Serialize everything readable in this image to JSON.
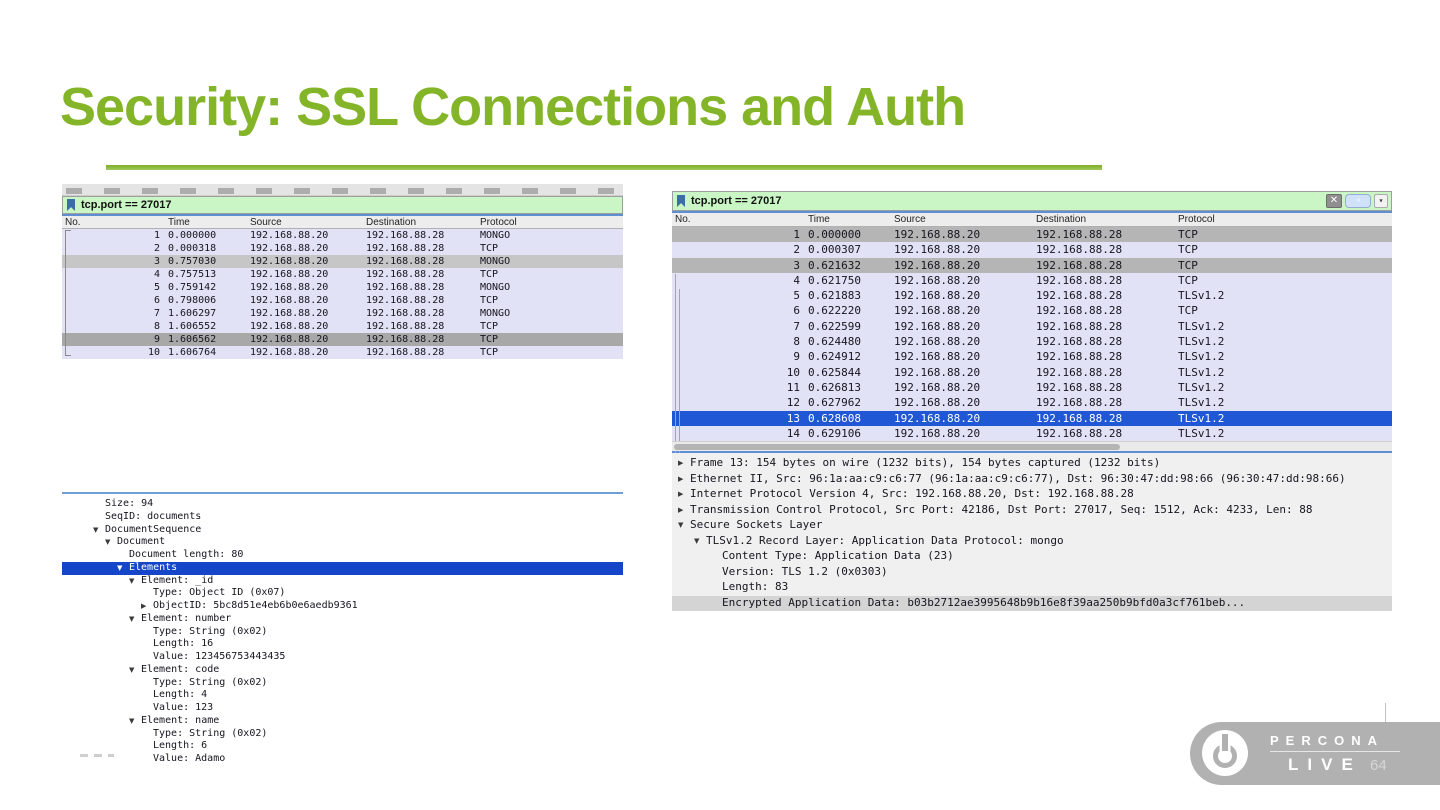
{
  "slide": {
    "title": "Security: SSL Connections and Auth",
    "page_number": "64"
  },
  "brand": {
    "name_top": "PERCONA",
    "name_bottom": "LIVE",
    "power_icon": "power-icon"
  },
  "colors": {
    "accent_green": "#84b529",
    "filter_green": "#c9f6c4",
    "row_lavender": "#e2e2f6",
    "selected_blue": "#1f57d5",
    "tree_selected_blue": "#1546c9",
    "highlight_gray": "#b5b5b5",
    "badge_gray": "#b1b1b1"
  },
  "left_capture": {
    "filter": "tcp.port == 27017",
    "columns": [
      "No.",
      "Time",
      "Source",
      "Destination",
      "Protocol"
    ],
    "rows": [
      {
        "no": "1",
        "time": "0.000000",
        "source": "192.168.88.20",
        "destination": "192.168.88.28",
        "protocol": "MONGO",
        "hl": ""
      },
      {
        "no": "2",
        "time": "0.000318",
        "source": "192.168.88.20",
        "destination": "192.168.88.28",
        "protocol": "TCP",
        "hl": ""
      },
      {
        "no": "3",
        "time": "0.757030",
        "source": "192.168.88.20",
        "destination": "192.168.88.28",
        "protocol": "MONGO",
        "hl": "gray1"
      },
      {
        "no": "4",
        "time": "0.757513",
        "source": "192.168.88.20",
        "destination": "192.168.88.28",
        "protocol": "TCP",
        "hl": ""
      },
      {
        "no": "5",
        "time": "0.759142",
        "source": "192.168.88.20",
        "destination": "192.168.88.28",
        "protocol": "MONGO",
        "hl": ""
      },
      {
        "no": "6",
        "time": "0.798006",
        "source": "192.168.88.20",
        "destination": "192.168.88.28",
        "protocol": "TCP",
        "hl": ""
      },
      {
        "no": "7",
        "time": "1.606297",
        "source": "192.168.88.20",
        "destination": "192.168.88.28",
        "protocol": "MONGO",
        "hl": ""
      },
      {
        "no": "8",
        "time": "1.606552",
        "source": "192.168.88.20",
        "destination": "192.168.88.28",
        "protocol": "TCP",
        "hl": ""
      },
      {
        "no": "9",
        "time": "1.606562",
        "source": "192.168.88.20",
        "destination": "192.168.88.28",
        "protocol": "TCP",
        "hl": "gray2"
      },
      {
        "no": "10",
        "time": "1.606764",
        "source": "192.168.88.20",
        "destination": "192.168.88.28",
        "protocol": "TCP",
        "hl": ""
      }
    ],
    "tree": [
      {
        "icon": "",
        "level": 0,
        "text": "Size: 94",
        "hl": ""
      },
      {
        "icon": "",
        "level": 0,
        "text": "SeqID: documents",
        "hl": ""
      },
      {
        "icon": "down",
        "level": 0,
        "text": "DocumentSequence",
        "hl": ""
      },
      {
        "icon": "down",
        "level": 1,
        "text": "Document",
        "hl": ""
      },
      {
        "icon": "",
        "level": 2,
        "text": "Document length: 80",
        "hl": ""
      },
      {
        "icon": "down",
        "level": 2,
        "text": "Elements",
        "hl": "treeblue"
      },
      {
        "icon": "down",
        "level": 3,
        "text": "Element: _id",
        "hl": ""
      },
      {
        "icon": "",
        "level": 4,
        "text": "Type: Object ID (0x07)",
        "hl": ""
      },
      {
        "icon": "right",
        "level": 4,
        "text": "ObjectID: 5bc8d51e4eb6b0e6aedb9361",
        "hl": ""
      },
      {
        "icon": "down",
        "level": 3,
        "text": "Element: number",
        "hl": ""
      },
      {
        "icon": "",
        "level": 4,
        "text": "Type: String (0x02)",
        "hl": ""
      },
      {
        "icon": "",
        "level": 4,
        "text": "Length: 16",
        "hl": ""
      },
      {
        "icon": "",
        "level": 4,
        "text": "Value: 123456753443435",
        "hl": ""
      },
      {
        "icon": "down",
        "level": 3,
        "text": "Element: code",
        "hl": ""
      },
      {
        "icon": "",
        "level": 4,
        "text": "Type: String (0x02)",
        "hl": ""
      },
      {
        "icon": "",
        "level": 4,
        "text": "Length: 4",
        "hl": ""
      },
      {
        "icon": "",
        "level": 4,
        "text": "Value: 123",
        "hl": ""
      },
      {
        "icon": "down",
        "level": 3,
        "text": "Element: name",
        "hl": ""
      },
      {
        "icon": "",
        "level": 4,
        "text": "Type: String (0x02)",
        "hl": ""
      },
      {
        "icon": "",
        "level": 4,
        "text": "Length: 6",
        "hl": ""
      },
      {
        "icon": "",
        "level": 4,
        "text": "Value: Adamo",
        "hl": ""
      }
    ]
  },
  "right_capture": {
    "filter": "tcp.port == 27017",
    "buttons": {
      "clear": "✕",
      "apply": "➔",
      "dropdown": "▾"
    },
    "columns": [
      "No.",
      "Time",
      "Source",
      "Destination",
      "Protocol"
    ],
    "rows": [
      {
        "no": "1",
        "time": "0.000000",
        "source": "192.168.88.20",
        "destination": "192.168.88.28",
        "protocol": "TCP",
        "hl": "gray3"
      },
      {
        "no": "2",
        "time": "0.000307",
        "source": "192.168.88.20",
        "destination": "192.168.88.28",
        "protocol": "TCP",
        "hl": ""
      },
      {
        "no": "3",
        "time": "0.621632",
        "source": "192.168.88.20",
        "destination": "192.168.88.28",
        "protocol": "TCP",
        "hl": "gray3"
      },
      {
        "no": "4",
        "time": "0.621750",
        "source": "192.168.88.20",
        "destination": "192.168.88.28",
        "protocol": "TCP",
        "hl": ""
      },
      {
        "no": "5",
        "time": "0.621883",
        "source": "192.168.88.20",
        "destination": "192.168.88.28",
        "protocol": "TLSv1.2",
        "hl": ""
      },
      {
        "no": "6",
        "time": "0.622220",
        "source": "192.168.88.20",
        "destination": "192.168.88.28",
        "protocol": "TCP",
        "hl": ""
      },
      {
        "no": "7",
        "time": "0.622599",
        "source": "192.168.88.20",
        "destination": "192.168.88.28",
        "protocol": "TLSv1.2",
        "hl": ""
      },
      {
        "no": "8",
        "time": "0.624480",
        "source": "192.168.88.20",
        "destination": "192.168.88.28",
        "protocol": "TLSv1.2",
        "hl": ""
      },
      {
        "no": "9",
        "time": "0.624912",
        "source": "192.168.88.20",
        "destination": "192.168.88.28",
        "protocol": "TLSv1.2",
        "hl": ""
      },
      {
        "no": "10",
        "time": "0.625844",
        "source": "192.168.88.20",
        "destination": "192.168.88.28",
        "protocol": "TLSv1.2",
        "hl": ""
      },
      {
        "no": "11",
        "time": "0.626813",
        "source": "192.168.88.20",
        "destination": "192.168.88.28",
        "protocol": "TLSv1.2",
        "hl": ""
      },
      {
        "no": "12",
        "time": "0.627962",
        "source": "192.168.88.20",
        "destination": "192.168.88.28",
        "protocol": "TLSv1.2",
        "hl": ""
      },
      {
        "no": "13",
        "time": "0.628608",
        "source": "192.168.88.20",
        "destination": "192.168.88.28",
        "protocol": "TLSv1.2",
        "hl": "blue"
      },
      {
        "no": "14",
        "time": "0.629106",
        "source": "192.168.88.20",
        "destination": "192.168.88.28",
        "protocol": "TLSv1.2",
        "hl": ""
      }
    ],
    "tree": [
      {
        "icon": "right",
        "level": 0,
        "text": "Frame 13: 154 bytes on wire (1232 bits), 154 bytes captured (1232 bits)",
        "hl": ""
      },
      {
        "icon": "right",
        "level": 0,
        "text": "Ethernet II, Src: 96:1a:aa:c9:c6:77 (96:1a:aa:c9:c6:77), Dst: 96:30:47:dd:98:66 (96:30:47:dd:98:66)",
        "hl": ""
      },
      {
        "icon": "right",
        "level": 0,
        "text": "Internet Protocol Version 4, Src: 192.168.88.20, Dst: 192.168.88.28",
        "hl": ""
      },
      {
        "icon": "right",
        "level": 0,
        "text": "Transmission Control Protocol, Src Port: 42186, Dst Port: 27017, Seq: 1512, Ack: 4233, Len: 88",
        "hl": ""
      },
      {
        "icon": "down",
        "level": 0,
        "text": "Secure Sockets Layer",
        "hl": ""
      },
      {
        "icon": "down",
        "level": 1,
        "text": "TLSv1.2 Record Layer: Application Data Protocol: mongo",
        "hl": ""
      },
      {
        "icon": "",
        "level": 2,
        "text": "Content Type: Application Data (23)",
        "hl": ""
      },
      {
        "icon": "",
        "level": 2,
        "text": "Version: TLS 1.2 (0x0303)",
        "hl": ""
      },
      {
        "icon": "",
        "level": 2,
        "text": "Length: 83",
        "hl": ""
      },
      {
        "icon": "",
        "level": 2,
        "text": "Encrypted Application Data: b03b2712ae3995648b9b16e8f39aa250b9bfd0a3cf761beb...",
        "hl": "treegray"
      }
    ]
  }
}
